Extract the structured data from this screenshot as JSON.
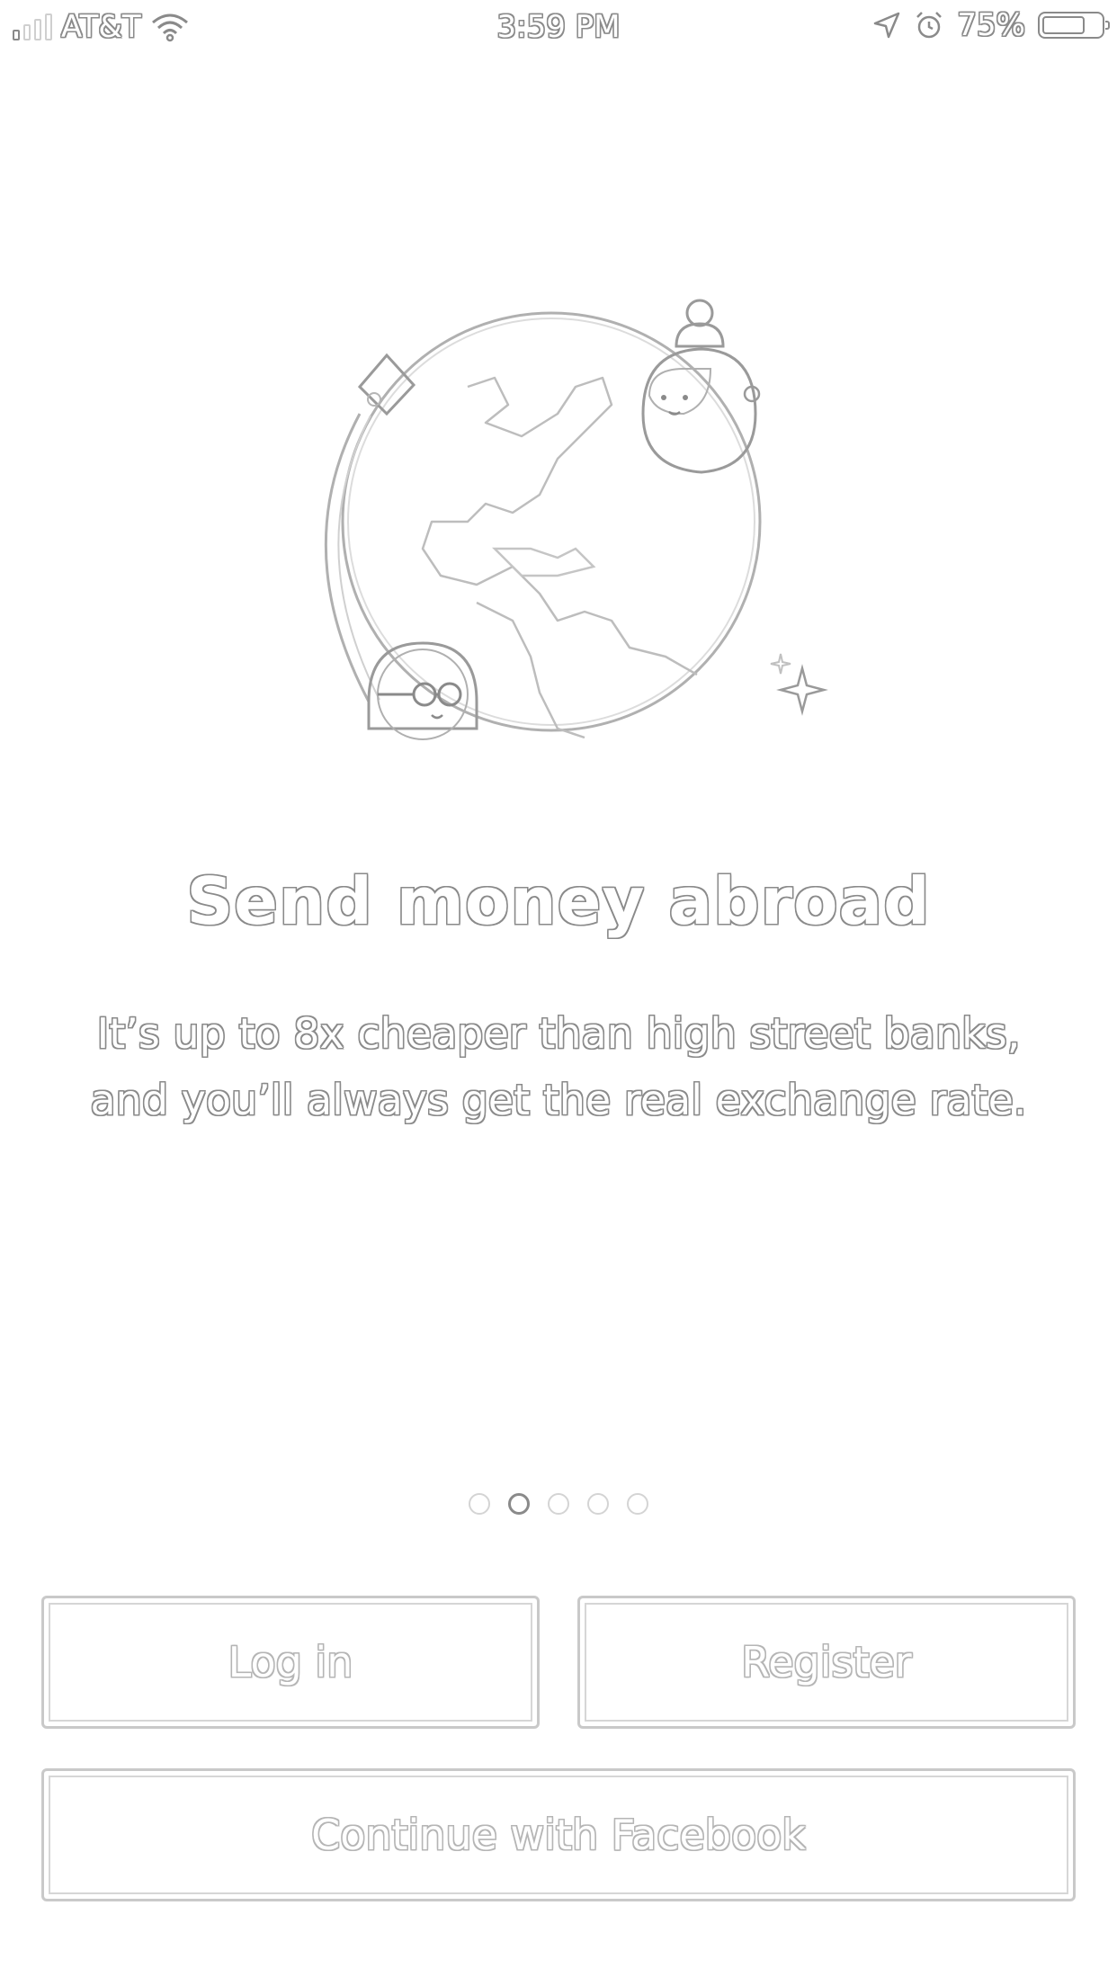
{
  "status_bar": {
    "carrier": "AT&T",
    "time": "3:59 PM",
    "battery": "75%",
    "battery_level": 0.75,
    "icons": [
      "signal-icon",
      "wifi-icon",
      "location-arrow-icon",
      "alarm-icon",
      "battery-icon"
    ]
  },
  "onboarding": {
    "illustration": "globe-with-characters",
    "title": "Send money abroad",
    "description_line1": "It’s up to 8x cheaper than high street banks,",
    "description_line2": "and you’ll always get the real exchange rate.",
    "pager": {
      "total": 5,
      "active_index": 1
    }
  },
  "actions": {
    "login_label": "Log in",
    "register_label": "Register",
    "facebook_label": "Continue with Facebook"
  },
  "colors": {
    "background": "#ffffff",
    "outline": "#8a8a8a",
    "button_border": "#c9c9c9"
  }
}
